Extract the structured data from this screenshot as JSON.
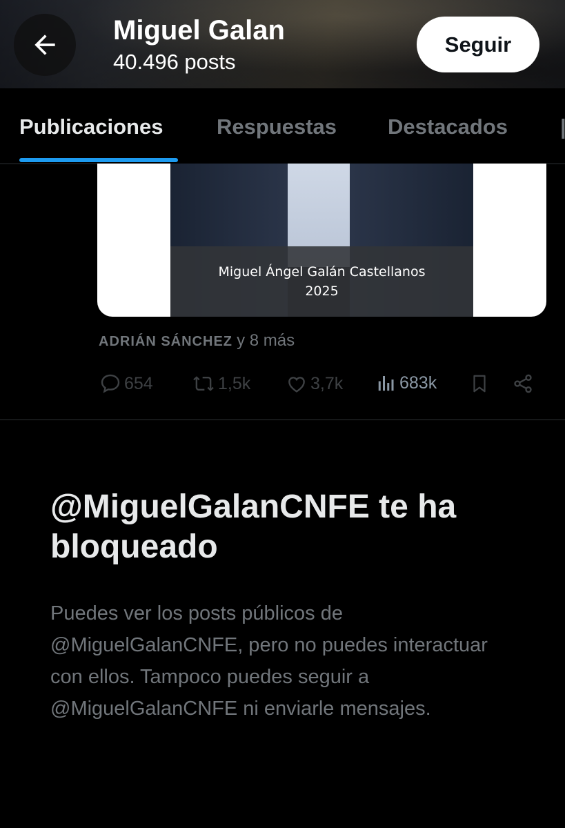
{
  "header": {
    "title": "Miguel Galan",
    "subtitle": "40.496 posts",
    "follow_label": "Seguir",
    "back_icon": "arrow-left-icon"
  },
  "tabs": [
    {
      "label": "Publicaciones",
      "active": true
    },
    {
      "label": "Respuestas",
      "active": false
    },
    {
      "label": "Destacados",
      "active": false
    }
  ],
  "post": {
    "image_caption_line1": "Miguel Ángel Galán Castellanos",
    "image_caption_line2": "2025",
    "social_names": "ADRIÁN SÁNCHEZ",
    "social_more": "y 8 más",
    "actions": {
      "replies": "654",
      "reposts": "1,5k",
      "likes": "3,7k",
      "views": "683k"
    }
  },
  "blocked": {
    "title": "@MiguelGalanCNFE te ha bloqueado",
    "body": "Puedes ver los posts públicos de @MiguelGalanCNFE, pero no puedes interactuar con ellos. Tampoco puedes seguir a @MiguelGalanCNFE ni enviarle mensajes."
  },
  "colors": {
    "accent": "#1d9bf0",
    "text_primary": "#e7e9ea",
    "text_secondary": "#71767b",
    "disabled_action": "#3e4144"
  }
}
